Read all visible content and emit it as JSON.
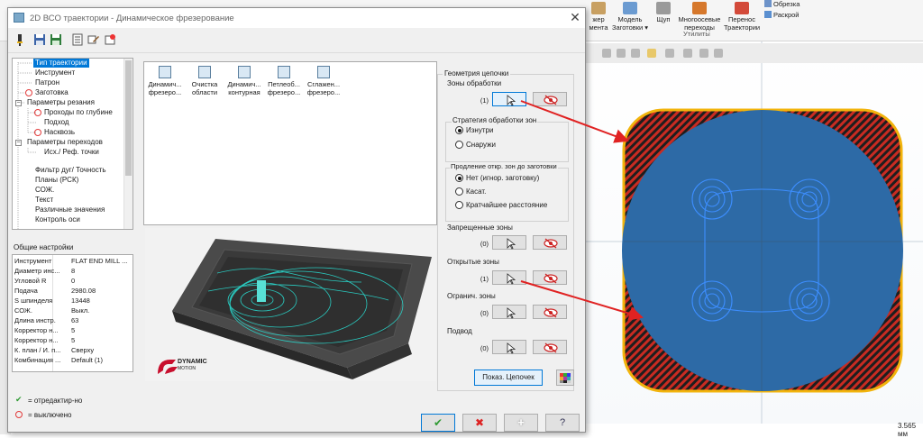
{
  "background_app": {
    "ribbon": {
      "buttons": [
        {
          "label": "жер\nмента"
        },
        {
          "label": "Модель\nЗаготовки ▾"
        },
        {
          "label": "Щуп"
        },
        {
          "label": "Многоосевые\nпереходы"
        },
        {
          "label": "Перенос\nТраектории"
        }
      ],
      "side_items": [
        "Обрезка",
        "Раскрой"
      ],
      "group_label": "Утилиты"
    },
    "status_scale": "3.565 мм"
  },
  "dialog": {
    "title": "2D ВСО траектории - Динамическое фрезерование",
    "close": "✕",
    "tree": {
      "items": [
        {
          "label": "Тип траектории",
          "selected": true
        },
        {
          "label": "Инструмент"
        },
        {
          "label": "Патрон"
        },
        {
          "label": "Заготовка",
          "disabled": true
        },
        {
          "label": "Параметры резания",
          "expand": "−"
        },
        {
          "label": "Проходы по глубине",
          "disabled": true
        },
        {
          "label": "Подход"
        },
        {
          "label": "Насквозь",
          "disabled": true
        },
        {
          "label": "Параметры переходов",
          "expand": "−"
        },
        {
          "label": "Исх./ Реф. точки"
        },
        {
          "label": "Фильтр дуг/ Точность"
        },
        {
          "label": "Планы (РСК)"
        },
        {
          "label": "СОЖ."
        },
        {
          "label": "Текст"
        },
        {
          "label": "Различные значения"
        },
        {
          "label": "Контроль оси"
        }
      ]
    },
    "general_settings": {
      "label": "Общие настройки",
      "rows": [
        {
          "name": "Инструмент",
          "value": "FLAT END MILL ..."
        },
        {
          "name": "Диаметр инс...",
          "value": "8"
        },
        {
          "name": "Угловой R",
          "value": "0"
        },
        {
          "name": "Подача",
          "value": "2980.08"
        },
        {
          "name": "S шпинделя",
          "value": "13448"
        },
        {
          "name": "СОЖ.",
          "value": "Выкл."
        },
        {
          "name": "Длина инстр.",
          "value": "63"
        },
        {
          "name": "Корректор н...",
          "value": "5"
        },
        {
          "name": "Корректор н...",
          "value": "5"
        },
        {
          "name": "К. план / И. п...",
          "value": "Сверху"
        },
        {
          "name": "Комбинация ...",
          "value": "Default (1)"
        }
      ]
    },
    "legend": {
      "edited": "= отредактир-но",
      "disabled": "= выключено"
    },
    "operations": [
      {
        "label": "Динамич...\nфрезеро...",
        "selected": true
      },
      {
        "label": "Очистка\nобласти"
      },
      {
        "label": "Динамич...\nконтурная"
      },
      {
        "label": "Петлеоб...\nфрезеро..."
      },
      {
        "label": "Сглажен...\nфрезеро..."
      }
    ],
    "preview_logo": {
      "line1": "DYNAMIC",
      "line2": "MOTION"
    },
    "chains": {
      "title": "Геометрия цепочки",
      "zones": {
        "label": "Зоны обработки",
        "count": "(1)"
      },
      "strategy": {
        "label": "Стратегия обработки зон",
        "options": [
          {
            "label": "Изнутри",
            "checked": true
          },
          {
            "label": "Снаружи",
            "checked": false
          }
        ]
      },
      "extension": {
        "label": "Продление откр. зон до заготовки",
        "options": [
          {
            "label": "Нет (игнор. заготовку)",
            "checked": true
          },
          {
            "label": "Касат.",
            "checked": false
          },
          {
            "label": "Кратчайшее расстояние",
            "checked": false
          }
        ]
      },
      "forbidden": {
        "label": "Запрещенные зоны",
        "count": "(0)"
      },
      "open": {
        "label": "Открытые зоны",
        "count": "(1)"
      },
      "limit": {
        "label": "Огранич. зоны",
        "count": "(0)"
      },
      "approach": {
        "label": "Подвод",
        "count": "(0)"
      },
      "show_chains": "Показ. Цепочек"
    },
    "buttons": {
      "ok": "✔",
      "cancel": "✖",
      "add": "+",
      "help": "?"
    }
  },
  "colors": {
    "selection": "#0078d7",
    "zone_fill": "#2d6aa6",
    "zone_border": "#f2b40c",
    "hatch_red": "#c92b22",
    "arrow_red": "#e02222",
    "toolpath": "#2e8bff"
  }
}
